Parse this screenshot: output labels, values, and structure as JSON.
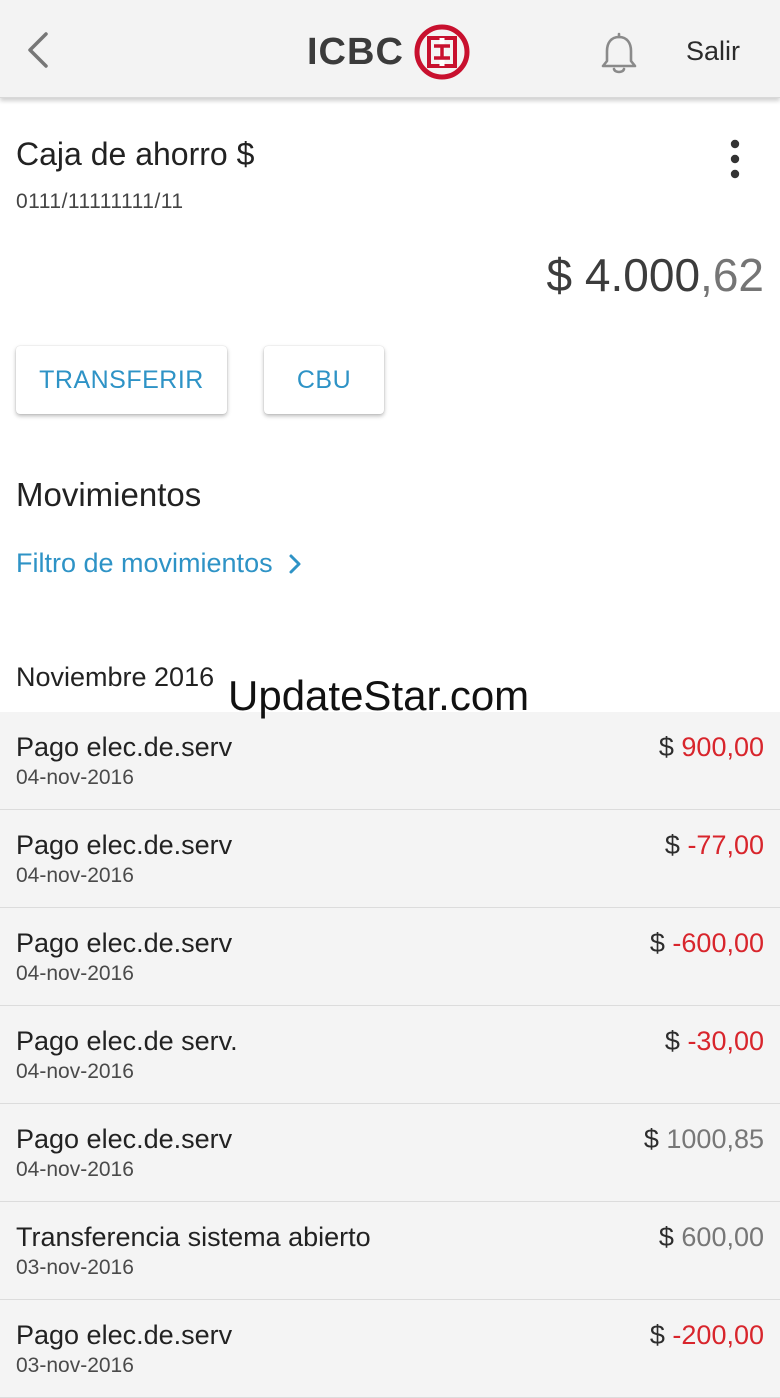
{
  "header": {
    "brand_text": "ICBC",
    "logout_label": "Salir",
    "brand_color": "#c8102e"
  },
  "account": {
    "title": "Caja de ahorro $",
    "number": "0111/11111111/11",
    "balance_currency": "$",
    "balance_integer": "4.000",
    "balance_decimals": ",62"
  },
  "actions": {
    "transfer_label": "TRANSFERIR",
    "cbu_label": "CBU"
  },
  "movements": {
    "section_title": "Movimientos",
    "filter_label": "Filtro de movimientos",
    "month_label": "Noviembre 2016",
    "items": [
      {
        "description": "Pago elec.de.serv",
        "date": "04-nov-2016",
        "currency": "$",
        "amount": "900,00",
        "type": "debit"
      },
      {
        "description": "Pago elec.de.serv",
        "date": "04-nov-2016",
        "currency": "$",
        "amount": "-77,00",
        "type": "debit"
      },
      {
        "description": "Pago elec.de.serv",
        "date": "04-nov-2016",
        "currency": "$",
        "amount": "-600,00",
        "type": "debit"
      },
      {
        "description": "Pago elec.de serv.",
        "date": "04-nov-2016",
        "currency": "$",
        "amount": "-30,00",
        "type": "debit"
      },
      {
        "description": "Pago elec.de.serv",
        "date": "04-nov-2016",
        "currency": "$",
        "amount": "1000,85",
        "type": "credit"
      },
      {
        "description": "Transferencia sistema abierto",
        "date": "03-nov-2016",
        "currency": "$",
        "amount": "600,00",
        "type": "credit"
      },
      {
        "description": "Pago elec.de.serv",
        "date": "03-nov-2016",
        "currency": "$",
        "amount": "-200,00",
        "type": "debit"
      }
    ]
  },
  "watermark": "UpdateStar.com",
  "colors": {
    "accent": "#2e93c6",
    "debit": "#d8252c",
    "credit": "#777777"
  }
}
